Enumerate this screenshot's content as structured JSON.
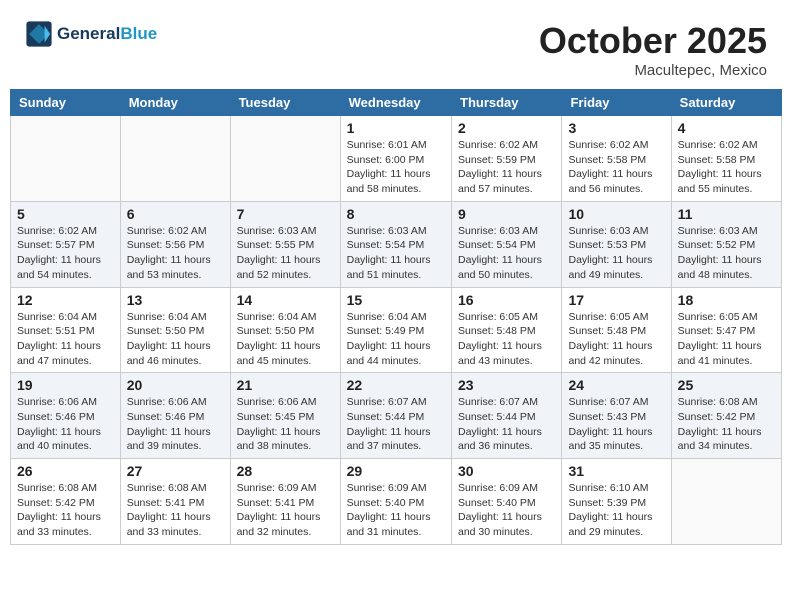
{
  "header": {
    "logo_line1": "General",
    "logo_line2": "Blue",
    "month": "October 2025",
    "location": "Macultepec, Mexico"
  },
  "weekdays": [
    "Sunday",
    "Monday",
    "Tuesday",
    "Wednesday",
    "Thursday",
    "Friday",
    "Saturday"
  ],
  "weeks": [
    [
      {
        "day": "",
        "info": ""
      },
      {
        "day": "",
        "info": ""
      },
      {
        "day": "",
        "info": ""
      },
      {
        "day": "1",
        "info": "Sunrise: 6:01 AM\nSunset: 6:00 PM\nDaylight: 11 hours and 58 minutes."
      },
      {
        "day": "2",
        "info": "Sunrise: 6:02 AM\nSunset: 5:59 PM\nDaylight: 11 hours and 57 minutes."
      },
      {
        "day": "3",
        "info": "Sunrise: 6:02 AM\nSunset: 5:58 PM\nDaylight: 11 hours and 56 minutes."
      },
      {
        "day": "4",
        "info": "Sunrise: 6:02 AM\nSunset: 5:58 PM\nDaylight: 11 hours and 55 minutes."
      }
    ],
    [
      {
        "day": "5",
        "info": "Sunrise: 6:02 AM\nSunset: 5:57 PM\nDaylight: 11 hours and 54 minutes."
      },
      {
        "day": "6",
        "info": "Sunrise: 6:02 AM\nSunset: 5:56 PM\nDaylight: 11 hours and 53 minutes."
      },
      {
        "day": "7",
        "info": "Sunrise: 6:03 AM\nSunset: 5:55 PM\nDaylight: 11 hours and 52 minutes."
      },
      {
        "day": "8",
        "info": "Sunrise: 6:03 AM\nSunset: 5:54 PM\nDaylight: 11 hours and 51 minutes."
      },
      {
        "day": "9",
        "info": "Sunrise: 6:03 AM\nSunset: 5:54 PM\nDaylight: 11 hours and 50 minutes."
      },
      {
        "day": "10",
        "info": "Sunrise: 6:03 AM\nSunset: 5:53 PM\nDaylight: 11 hours and 49 minutes."
      },
      {
        "day": "11",
        "info": "Sunrise: 6:03 AM\nSunset: 5:52 PM\nDaylight: 11 hours and 48 minutes."
      }
    ],
    [
      {
        "day": "12",
        "info": "Sunrise: 6:04 AM\nSunset: 5:51 PM\nDaylight: 11 hours and 47 minutes."
      },
      {
        "day": "13",
        "info": "Sunrise: 6:04 AM\nSunset: 5:50 PM\nDaylight: 11 hours and 46 minutes."
      },
      {
        "day": "14",
        "info": "Sunrise: 6:04 AM\nSunset: 5:50 PM\nDaylight: 11 hours and 45 minutes."
      },
      {
        "day": "15",
        "info": "Sunrise: 6:04 AM\nSunset: 5:49 PM\nDaylight: 11 hours and 44 minutes."
      },
      {
        "day": "16",
        "info": "Sunrise: 6:05 AM\nSunset: 5:48 PM\nDaylight: 11 hours and 43 minutes."
      },
      {
        "day": "17",
        "info": "Sunrise: 6:05 AM\nSunset: 5:48 PM\nDaylight: 11 hours and 42 minutes."
      },
      {
        "day": "18",
        "info": "Sunrise: 6:05 AM\nSunset: 5:47 PM\nDaylight: 11 hours and 41 minutes."
      }
    ],
    [
      {
        "day": "19",
        "info": "Sunrise: 6:06 AM\nSunset: 5:46 PM\nDaylight: 11 hours and 40 minutes."
      },
      {
        "day": "20",
        "info": "Sunrise: 6:06 AM\nSunset: 5:46 PM\nDaylight: 11 hours and 39 minutes."
      },
      {
        "day": "21",
        "info": "Sunrise: 6:06 AM\nSunset: 5:45 PM\nDaylight: 11 hours and 38 minutes."
      },
      {
        "day": "22",
        "info": "Sunrise: 6:07 AM\nSunset: 5:44 PM\nDaylight: 11 hours and 37 minutes."
      },
      {
        "day": "23",
        "info": "Sunrise: 6:07 AM\nSunset: 5:44 PM\nDaylight: 11 hours and 36 minutes."
      },
      {
        "day": "24",
        "info": "Sunrise: 6:07 AM\nSunset: 5:43 PM\nDaylight: 11 hours and 35 minutes."
      },
      {
        "day": "25",
        "info": "Sunrise: 6:08 AM\nSunset: 5:42 PM\nDaylight: 11 hours and 34 minutes."
      }
    ],
    [
      {
        "day": "26",
        "info": "Sunrise: 6:08 AM\nSunset: 5:42 PM\nDaylight: 11 hours and 33 minutes."
      },
      {
        "day": "27",
        "info": "Sunrise: 6:08 AM\nSunset: 5:41 PM\nDaylight: 11 hours and 33 minutes."
      },
      {
        "day": "28",
        "info": "Sunrise: 6:09 AM\nSunset: 5:41 PM\nDaylight: 11 hours and 32 minutes."
      },
      {
        "day": "29",
        "info": "Sunrise: 6:09 AM\nSunset: 5:40 PM\nDaylight: 11 hours and 31 minutes."
      },
      {
        "day": "30",
        "info": "Sunrise: 6:09 AM\nSunset: 5:40 PM\nDaylight: 11 hours and 30 minutes."
      },
      {
        "day": "31",
        "info": "Sunrise: 6:10 AM\nSunset: 5:39 PM\nDaylight: 11 hours and 29 minutes."
      },
      {
        "day": "",
        "info": ""
      }
    ]
  ]
}
